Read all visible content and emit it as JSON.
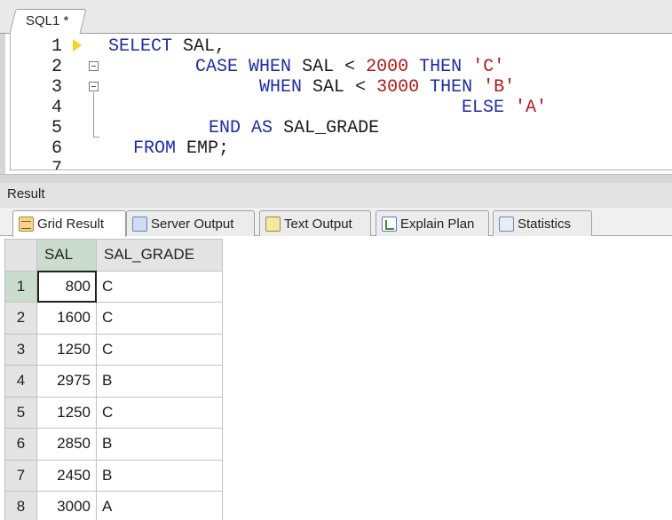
{
  "editor": {
    "tab_label": "SQL1 *",
    "line_numbers": [
      "1",
      "2",
      "3",
      "4",
      "5",
      "6",
      "7"
    ]
  },
  "sql": {
    "l1_kw": "SELECT",
    "l1_rest": "SAL,",
    "l2_case": "CASE",
    "l2_when": "WHEN",
    "l2_col": "SAL",
    "l2_op": "<",
    "l2_num": "2000",
    "l2_then": "THEN",
    "l2_val": "'C'",
    "l3_when": "WHEN",
    "l3_col": "SAL",
    "l3_op": "<",
    "l3_num": "3000",
    "l3_then": "THEN",
    "l3_val": "'B'",
    "l4_else": "ELSE",
    "l4_val": "'A'",
    "l5_end": "END",
    "l5_as": "AS",
    "l5_alias": "SAL_GRADE",
    "l6_from": "FROM",
    "l6_table": "EMP;"
  },
  "result": {
    "panel_title": "Result",
    "tabs": [
      {
        "label": "Grid Result",
        "icon": "grid-icon",
        "active": true
      },
      {
        "label": "Server Output",
        "icon": "server-output-icon",
        "active": false
      },
      {
        "label": "Text Output",
        "icon": "text-output-icon",
        "active": false
      },
      {
        "label": "Explain Plan",
        "icon": "explain-plan-icon",
        "active": false
      },
      {
        "label": "Statistics",
        "icon": "statistics-icon",
        "active": false
      }
    ],
    "columns": [
      "SAL",
      "SAL_GRADE"
    ],
    "rows": [
      {
        "n": "1",
        "sal": "800",
        "grade": "C"
      },
      {
        "n": "2",
        "sal": "1600",
        "grade": "C"
      },
      {
        "n": "3",
        "sal": "1250",
        "grade": "C"
      },
      {
        "n": "4",
        "sal": "2975",
        "grade": "B"
      },
      {
        "n": "5",
        "sal": "1250",
        "grade": "C"
      },
      {
        "n": "6",
        "sal": "2850",
        "grade": "B"
      },
      {
        "n": "7",
        "sal": "2450",
        "grade": "B"
      },
      {
        "n": "8",
        "sal": "3000",
        "grade": "A"
      }
    ]
  },
  "colors": {
    "keyword": "#1d2ca6",
    "literal": "#b31818",
    "selected_header": "#c9dccd"
  }
}
